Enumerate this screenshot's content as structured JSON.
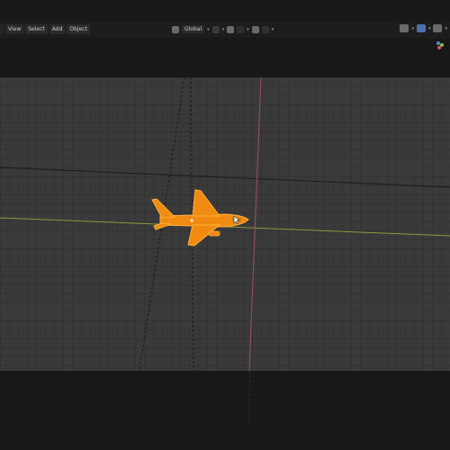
{
  "header": {
    "menu": [
      {
        "label": "",
        "name": "editor-type-menu"
      },
      {
        "label": "View",
        "name": "view-menu"
      },
      {
        "label": "Select",
        "name": "select-menu"
      },
      {
        "label": "Add",
        "name": "add-menu"
      },
      {
        "label": "Object",
        "name": "object-menu"
      }
    ],
    "orientation": "Global"
  },
  "viewport": {
    "object": "airplane",
    "selection_color": "#f08a10",
    "x_axis_color": "#8a9a3a",
    "y_axis_color": "#a05060"
  }
}
